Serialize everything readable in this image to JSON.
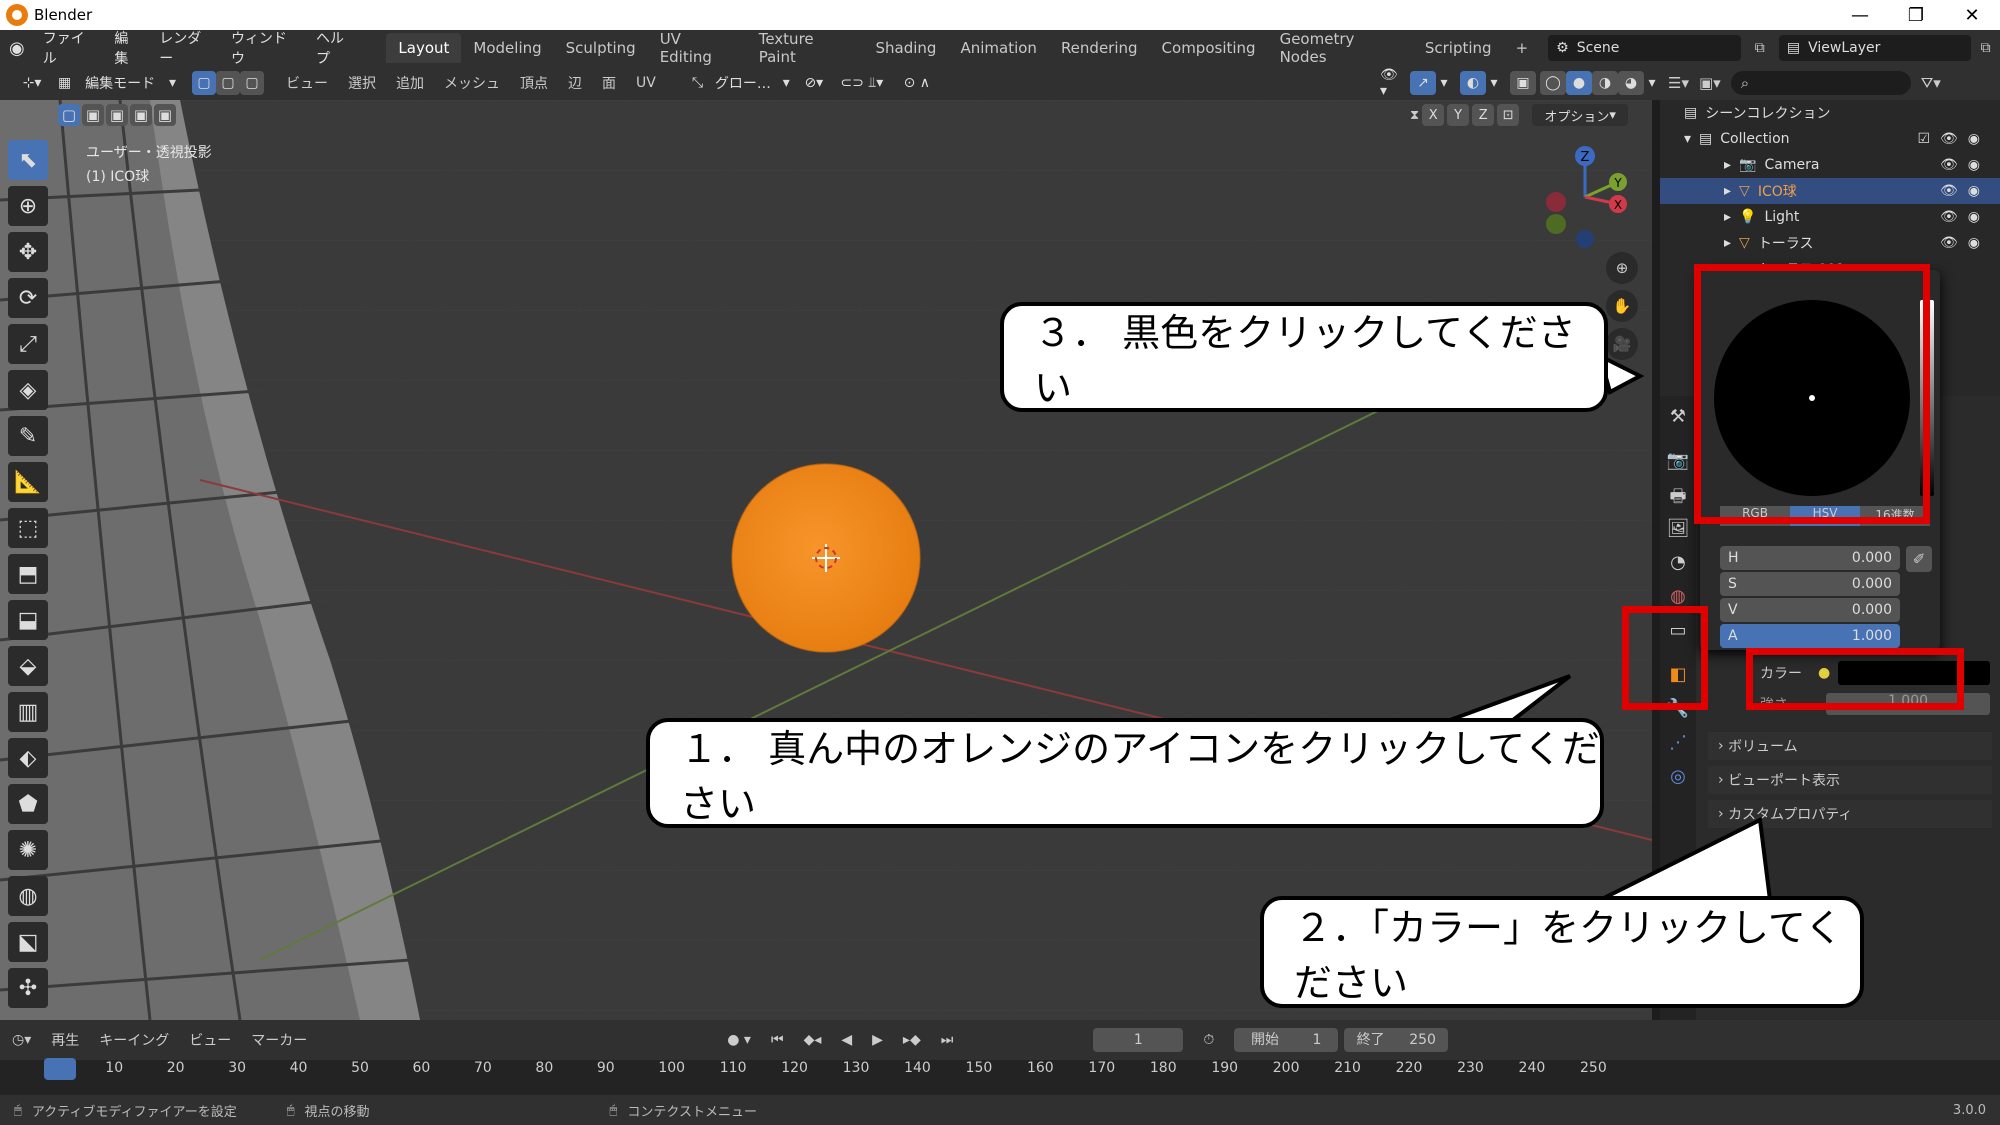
{
  "titlebar": {
    "app": "Blender",
    "minimize": "—",
    "maximize": "❐",
    "close": "✕"
  },
  "menu": [
    "ファイル",
    "編集",
    "レンダー",
    "ウィンドウ",
    "ヘルプ"
  ],
  "workspaces": [
    "Layout",
    "Modeling",
    "Sculpting",
    "UV Editing",
    "Texture Paint",
    "Shading",
    "Animation",
    "Rendering",
    "Compositing",
    "Geometry Nodes",
    "Scripting"
  ],
  "active_workspace": "Layout",
  "scene": "Scene",
  "view_layer": "ViewLayer",
  "toolrow": {
    "mode": "編集モード",
    "items": [
      "ビュー",
      "選択",
      "追加",
      "メッシュ",
      "頂点",
      "辺",
      "面",
      "UV"
    ],
    "transform": "グロー…",
    "options": "オプション",
    "axes": [
      "X",
      "Y",
      "Z"
    ]
  },
  "viewport": {
    "view_name": "ユーザー・透視投影",
    "object_name": "(1) ICO球",
    "object_color": "#f08a1c"
  },
  "gizmo": {
    "z": "Z",
    "y": "Y",
    "x": "X"
  },
  "outliner": {
    "title": "シーンコレクション",
    "collection": "Collection",
    "items": [
      "Camera",
      "ICO球",
      "Light",
      "トーラス",
      "トーラス.001"
    ]
  },
  "color_picker": {
    "h": {
      "label": "H",
      "value": "0.000"
    },
    "s": {
      "label": "S",
      "value": "0.000"
    },
    "v": {
      "label": "V",
      "value": "0.000"
    },
    "a": {
      "label": "A",
      "value": "1.000"
    },
    "mode_tabs": [
      "RGB",
      "HSV",
      "16進数"
    ]
  },
  "properties": {
    "color_label": "カラー",
    "strength_label": "強さ",
    "strength_value": "1.000",
    "panels": [
      "ボリューム",
      "ビューポート表示",
      "カスタムプロパティ"
    ]
  },
  "timeline": {
    "menu": [
      "再生",
      "キーイング",
      "ビュー",
      "マーカー"
    ],
    "current_frame": "1",
    "start_label": "開始",
    "start": "1",
    "end_label": "終了",
    "end": "250",
    "ticks": [
      "1",
      "10",
      "20",
      "30",
      "40",
      "50",
      "60",
      "70",
      "80",
      "90",
      "100",
      "110",
      "120",
      "130",
      "140",
      "150",
      "160",
      "170",
      "180",
      "190",
      "200",
      "210",
      "220",
      "230",
      "240",
      "250"
    ]
  },
  "statusbar": {
    "left": "アクティブモディファイアーを設定",
    "mid": "視点の移動",
    "right": "コンテクストメニュー",
    "version": "3.0.0"
  },
  "callouts": {
    "step1": "１． 真ん中のオレンジのアイコンをクリックしてください",
    "step2": "２．「カラー」をクリックしてください",
    "step3": "３． 黒色をクリックしてください"
  },
  "colors": {
    "accent": "#4772b3",
    "highlight": "#e00000",
    "orange": "#f08a1c"
  }
}
